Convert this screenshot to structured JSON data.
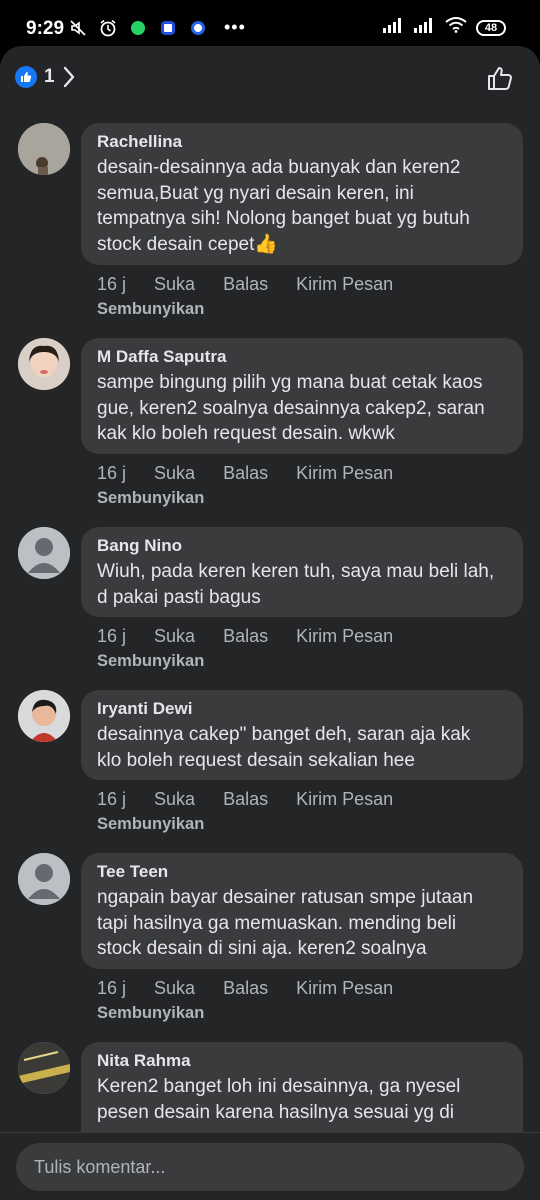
{
  "status_bar": {
    "time": "9:29",
    "battery": "48"
  },
  "header": {
    "like_count": "1"
  },
  "comments": [
    {
      "name": "Rachellina",
      "text": "desain-desainnya ada buanyak dan keren2\nsemua,Buat yg nyari desain keren, ini\ntempatnya sih! Nolong banget buat yg butuh\nstock desain cepet👍",
      "time": "16 j",
      "like": "Suka",
      "reply": "Balas",
      "message": "Kirim Pesan",
      "hide": "Sembunyikan"
    },
    {
      "name": "M Daffa Saputra",
      "text": "sampe bingung pilih yg mana buat cetak kaos\ngue, keren2 soalnya desainnya cakep2, saran\nkak klo boleh request desain. wkwk",
      "time": "16 j",
      "like": "Suka",
      "reply": "Balas",
      "message": "Kirim Pesan",
      "hide": "Sembunyikan"
    },
    {
      "name": "Bang Nino",
      "text": "Wiuh, pada keren keren tuh, saya mau beli lah,\nd pakai pasti bagus",
      "time": "16 j",
      "like": "Suka",
      "reply": "Balas",
      "message": "Kirim Pesan",
      "hide": "Sembunyikan"
    },
    {
      "name": "Iryanti Dewi",
      "text": "desainnya cakep\" banget deh, saran aja kak\nklo boleh request desain sekalian hee",
      "time": "16 j",
      "like": "Suka",
      "reply": "Balas",
      "message": "Kirim Pesan",
      "hide": "Sembunyikan"
    },
    {
      "name": "Tee Teen",
      "text": "ngapain bayar desainer ratusan smpe jutaan\ntapi hasilnya ga memuaskan. mending beli\nstock desain di sini aja. keren2 soalnya",
      "time": "16 j",
      "like": "Suka",
      "reply": "Balas",
      "message": "Kirim Pesan",
      "hide": "Sembunyikan"
    },
    {
      "name": "Nita Rahma",
      "text": "Keren2 banget loh ini desainnya, ga nyesel\npesen desain karena hasilnya sesuai yg di",
      "time": "",
      "like": "",
      "reply": "",
      "message": "",
      "hide": ""
    }
  ],
  "composer": {
    "placeholder": "Tulis komentar..."
  },
  "colors": {
    "accent": "#1877f2",
    "background": "#242526",
    "bubble": "#3a3b3c",
    "secondary_text": "#b0b3b8"
  }
}
